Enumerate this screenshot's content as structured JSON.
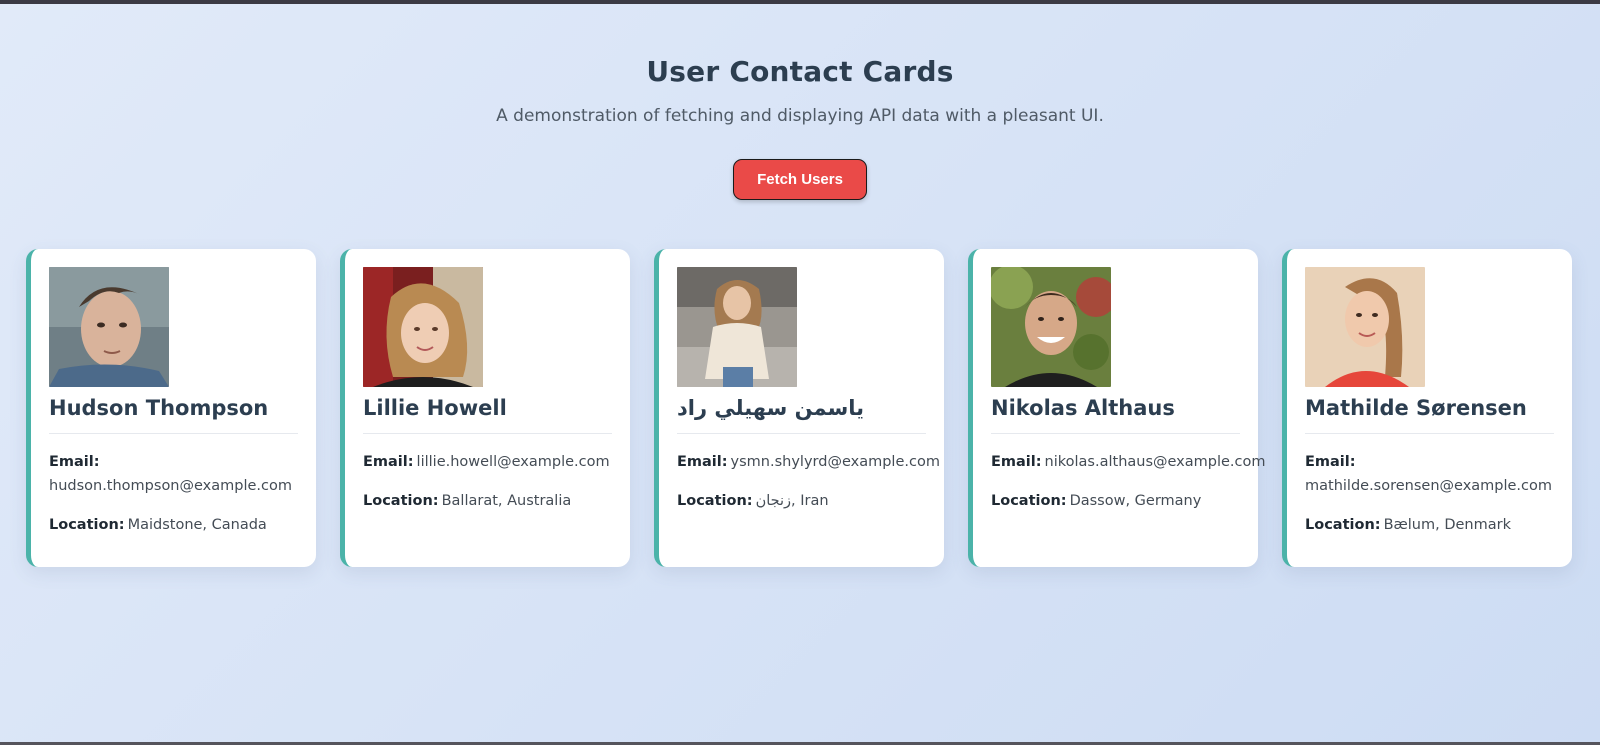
{
  "header": {
    "title": "User Contact Cards",
    "subtitle": "A demonstration of fetching and displaying API data with a pleasant UI.",
    "fetch_button_label": "Fetch Users"
  },
  "labels": {
    "email": "Email:",
    "location": "Location:"
  },
  "colors": {
    "accent_border": "#4bb3a9",
    "button": "#ea4a48",
    "title": "#2c3e50"
  },
  "users": [
    {
      "name": "Hudson Thompson",
      "email": "hudson.thompson@example.com",
      "location": "Maidstone, Canada"
    },
    {
      "name": "Lillie Howell",
      "email": "lillie.howell@example.com",
      "location": "Ballarat, Australia"
    },
    {
      "name": "یاسمن سهيلي راد",
      "email": "ysmn.shylyrd@example.com",
      "location": "زنجان, Iran"
    },
    {
      "name": "Nikolas Althaus",
      "email": "nikolas.althaus@example.com",
      "location": "Dassow, Germany"
    },
    {
      "name": "Mathilde Sørensen",
      "email": "mathilde.sorensen@example.com",
      "location": "Bælum, Denmark"
    }
  ]
}
